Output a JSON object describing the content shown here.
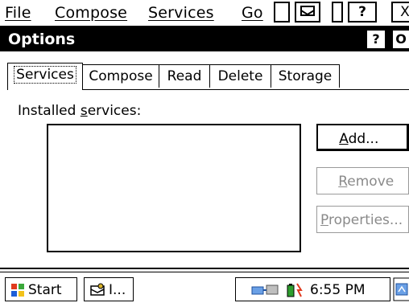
{
  "menubar": {
    "items": [
      "File",
      "Compose",
      "Services",
      "Go"
    ],
    "help_label": "?",
    "close_label": "X"
  },
  "window": {
    "title": "Options",
    "help_label": "?",
    "ok_label": "O"
  },
  "tabs": [
    {
      "label": "Services",
      "active": true
    },
    {
      "label": "Compose",
      "active": false
    },
    {
      "label": "Read",
      "active": false
    },
    {
      "label": "Delete",
      "active": false
    },
    {
      "label": "Storage",
      "active": false
    }
  ],
  "services": {
    "label_prefix": "Installed ",
    "label_accel": "s",
    "label_suffix": "ervices:",
    "items": []
  },
  "buttons": {
    "add": {
      "accel": "A",
      "rest": "dd...",
      "enabled": true
    },
    "remove": {
      "accel": "R",
      "rest": "emove",
      "enabled": false
    },
    "properties": {
      "accel": "P",
      "rest": "roperties...",
      "enabled": false
    }
  },
  "taskbar": {
    "start_label": "Start",
    "task_label": "I...",
    "clock": "6:55 PM"
  },
  "colors": {
    "titlebar": "#000000",
    "start_flag": [
      "#e03a1e",
      "#3aa83a",
      "#1e5fd8",
      "#f2c21a"
    ]
  }
}
